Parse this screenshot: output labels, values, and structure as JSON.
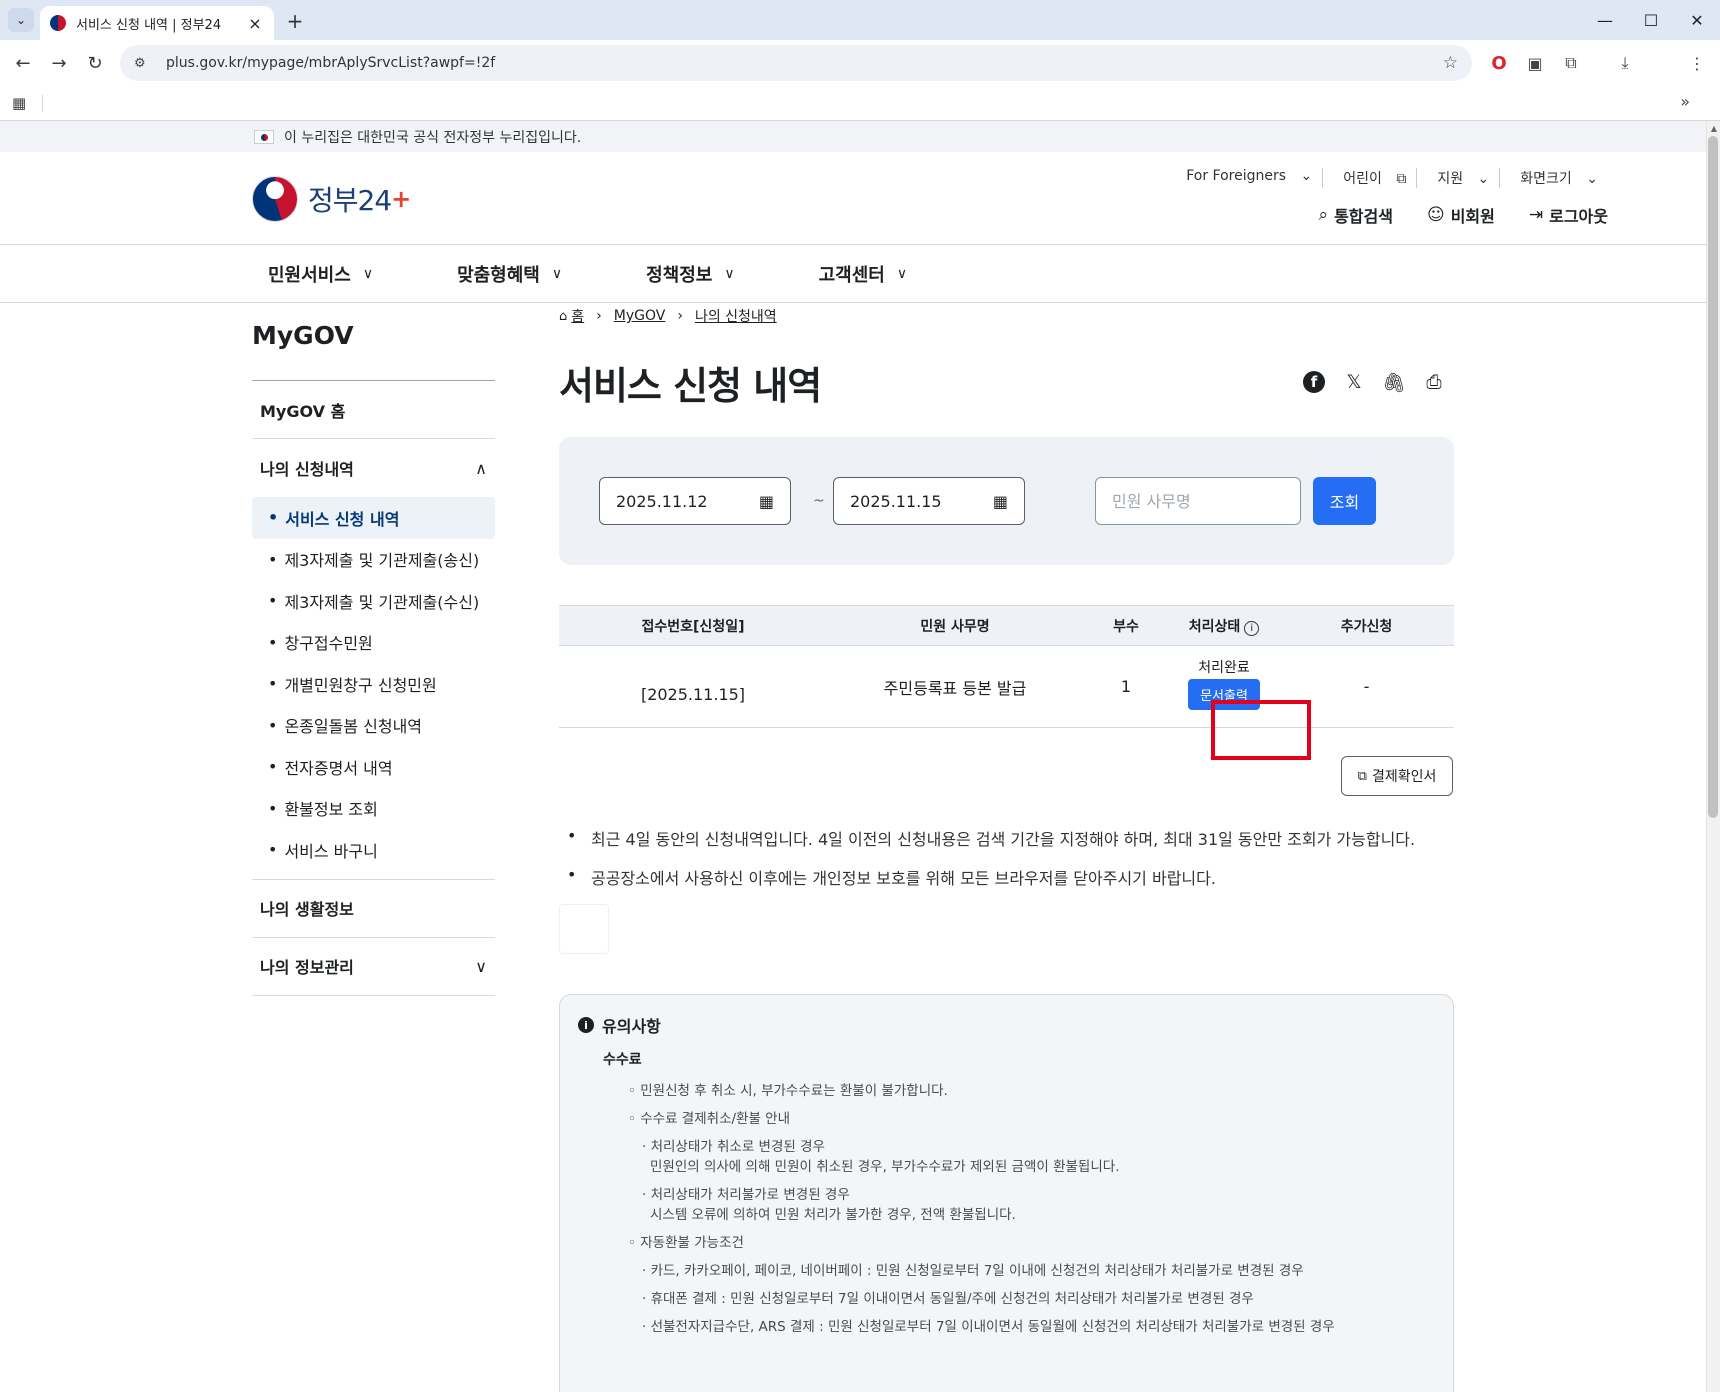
{
  "browser": {
    "tab_title": "서비스 신청 내역 | 정부24",
    "url": "plus.gov.kr/mypage/mbrAplySrvcList?awpf=!2f"
  },
  "banner": {
    "text": "이 누리집은 대한민국 공식 전자정부 누리집입니다."
  },
  "header": {
    "logo_text": "정부24",
    "util_links": [
      "For Foreigners",
      "어린이",
      "지원",
      "화면크기"
    ],
    "account_links": {
      "search": "통합검색",
      "member": "비회원",
      "logout": "로그아웃"
    }
  },
  "gnb": {
    "menus": [
      "민원서비스",
      "맞춤형혜택",
      "정책정보",
      "고객센터"
    ]
  },
  "sidebar": {
    "title": "MyGOV",
    "home": "MyGOV 홈",
    "section_apply": "나의 신청내역",
    "items": [
      "서비스 신청 내역",
      "제3자제출 및 기관제출(송신)",
      "제3자제출 및 기관제출(수신)",
      "창구접수민원",
      "개별민원창구 신청민원",
      "온종일돌봄 신청내역",
      "전자증명서 내역",
      "환불정보 조회",
      "서비스 바구니"
    ],
    "section_life": "나의 생활정보",
    "section_info": "나의 정보관리"
  },
  "breadcrumb": {
    "home": "홈",
    "level1": "MyGOV",
    "level2": "나의 신청내역"
  },
  "page_title": "서비스 신청 내역",
  "search": {
    "date_from": "2025.11.12",
    "date_to": "2025.11.15",
    "separator": "~",
    "name_placeholder": "민원 사무명",
    "search_label": "조회"
  },
  "table": {
    "headers": [
      "접수번호[신청일]",
      "민원 사무명",
      "부수",
      "처리상태",
      "추가신청"
    ],
    "rows": [
      {
        "regno": "[2025.11.15]",
        "name": "주민등록표 등본 발급",
        "copies": "1",
        "status": "처리완료",
        "action": "문서출력",
        "extra": "-"
      }
    ]
  },
  "receipt_label": "결제확인서",
  "notes": [
    "최근 4일 동안의 신청내역입니다. 4일 이전의 신청내용은 검색 기간을 지정해야 하며, 최대 31일 동안만 조회가 가능합니다.",
    "공공장소에서 사용하신 이후에는 개인정보 보호를 위해 모든 브라우저를 닫아주시기 바랍니다."
  ],
  "notice": {
    "title": "유의사항",
    "sub": "수수료",
    "lines": [
      "◦ 민원신청 후 취소 시, 부가수수료는 환불이 불가합니다.",
      "◦ 수수료 결제취소/환불 안내",
      "· 처리상태가 취소로 변경된 경우",
      "민원인의 의사에 의해 민원이 취소된 경우, 부가수수료가 제외된 금액이 환불됩니다.",
      "· 처리상태가 처리불가로 변경된 경우",
      "시스템 오류에 의하여 민원 처리가 불가한 경우, 전액 환불됩니다.",
      "◦ 자동환불 가능조건",
      "· 카드, 카카오페이, 페이코, 네이버페이 : 민원 신청일로부터 7일 이내에 신청건의 처리상태가 처리불가로 변경된 경우",
      "· 휴대폰 결제 : 민원 신청일로부터 7일 이내이면서 동일월/주에 신청건의 처리상태가 처리불가로 변경된 경우",
      "· 선불전자지급수단, ARS 결제 : 민원 신청일로부터 7일 이내이면서 동일월에 신청건의 처리상태가 처리불가로 변경된 경우"
    ]
  },
  "colors": {
    "primary": "#256ef4",
    "highlight": "#e3001b",
    "brand": "#1d3e77"
  }
}
